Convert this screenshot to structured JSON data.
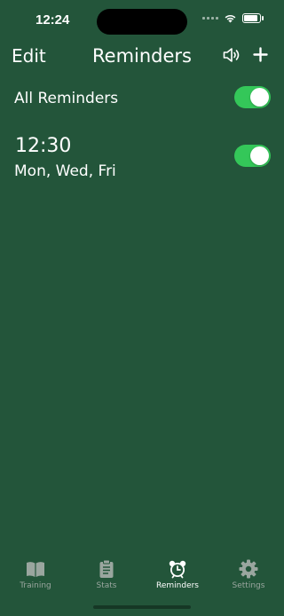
{
  "status_bar": {
    "time": "12:24"
  },
  "nav": {
    "edit_label": "Edit",
    "title": "Reminders"
  },
  "all_reminders": {
    "label": "All Reminders",
    "enabled": true
  },
  "reminders": [
    {
      "time": "12:30",
      "days": "Mon, Wed, Fri",
      "enabled": true
    }
  ],
  "tabs": [
    {
      "label": "Training",
      "icon": "book-icon",
      "active": false
    },
    {
      "label": "Stats",
      "icon": "clipboard-icon",
      "active": false
    },
    {
      "label": "Reminders",
      "icon": "alarm-clock-icon",
      "active": true
    },
    {
      "label": "Settings",
      "icon": "gear-icon",
      "active": false
    }
  ],
  "colors": {
    "background": "#23553a",
    "toggle_on": "#34c759",
    "tab_inactive": "#9aa69f",
    "tab_active": "#ffffff"
  }
}
